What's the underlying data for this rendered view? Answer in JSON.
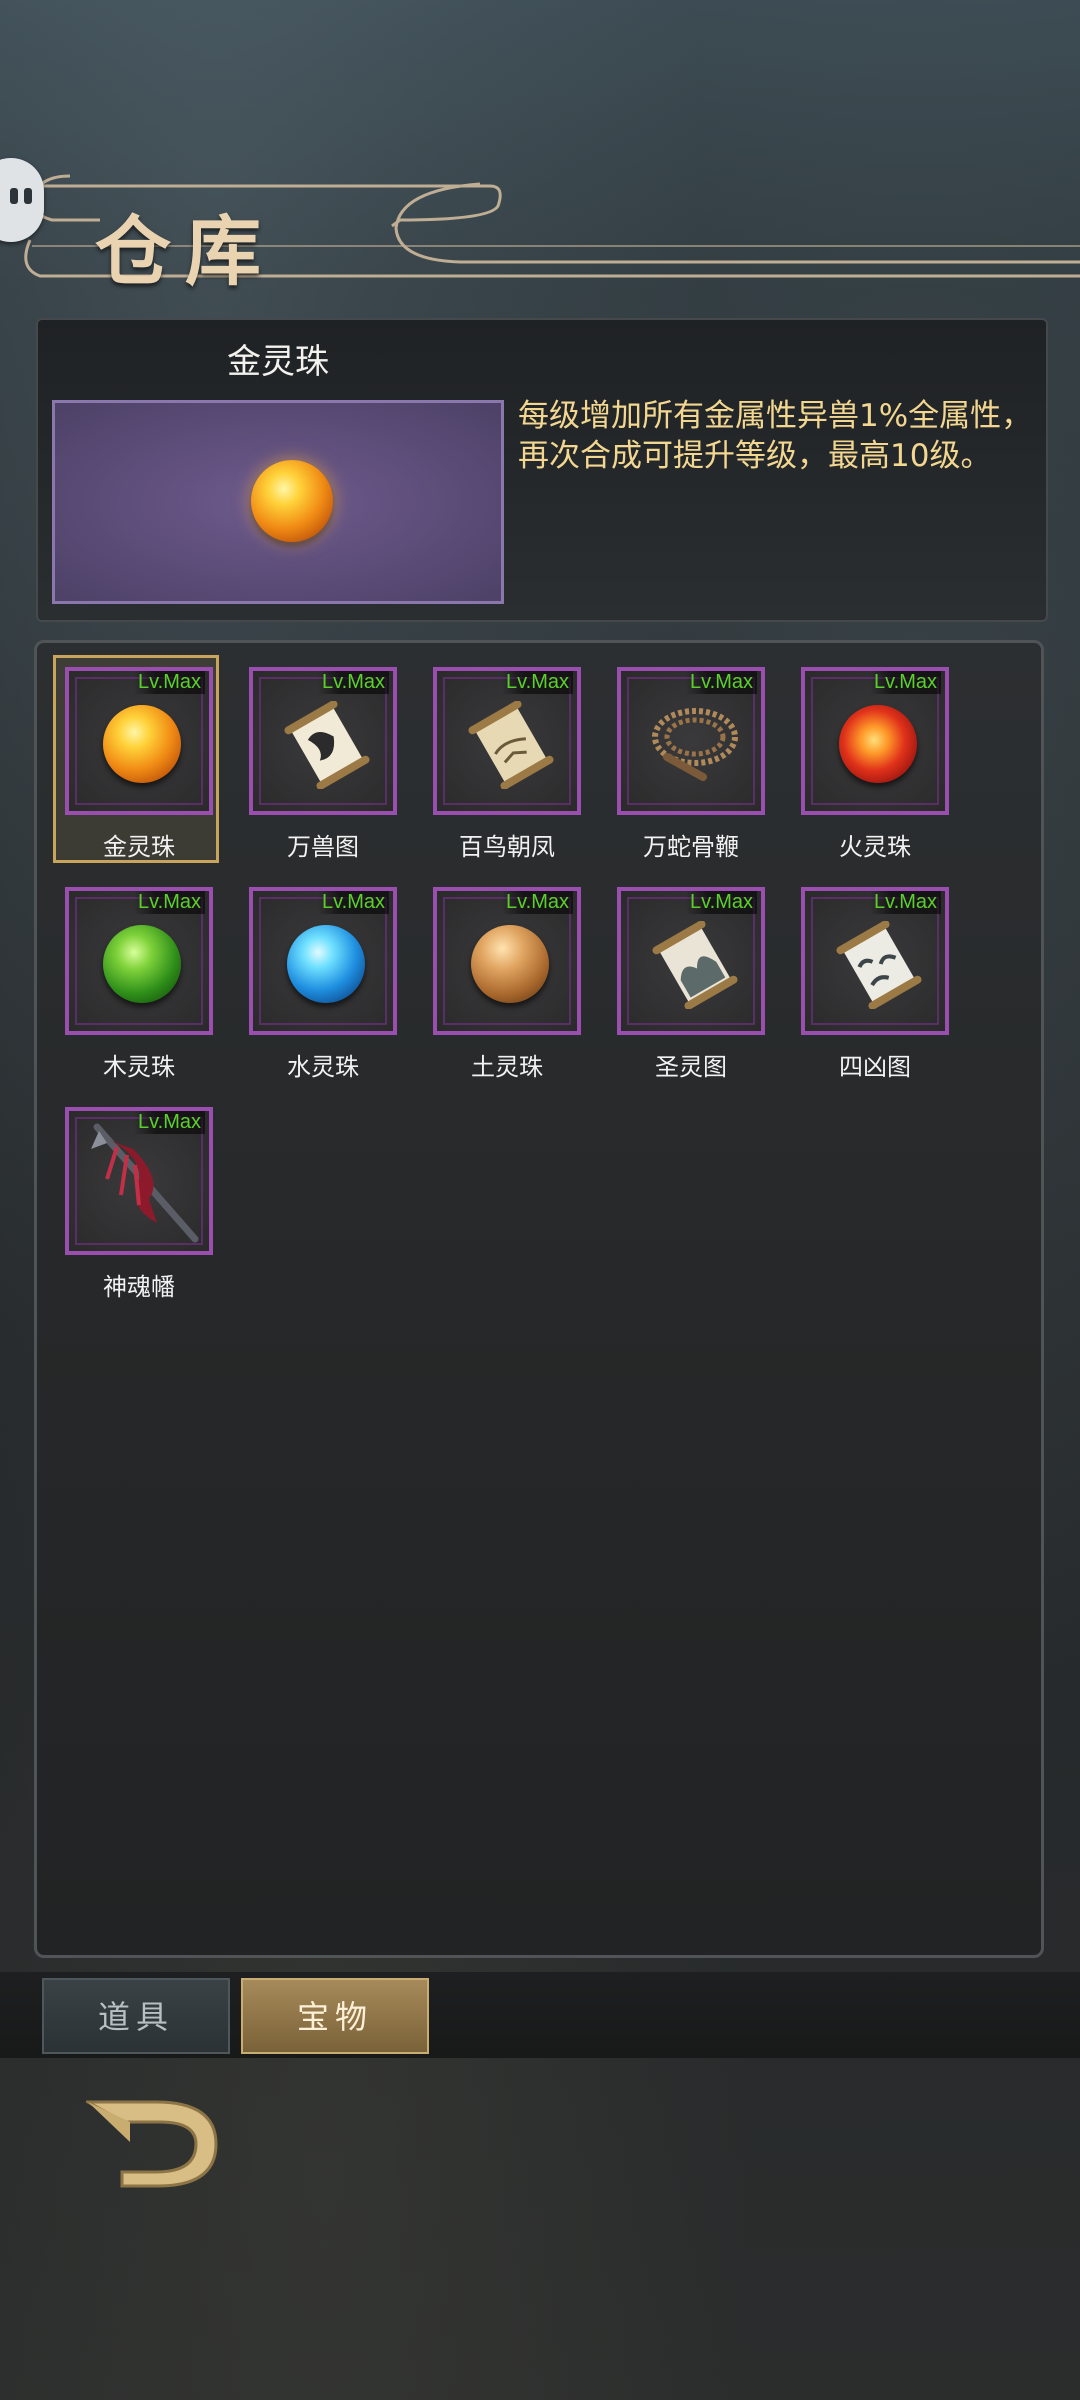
{
  "header": {
    "title": "仓库"
  },
  "detail": {
    "name": "金灵珠",
    "description": "每级增加所有金属性异兽1%全属性，再次合成可提升等级，最高10级。"
  },
  "inventory": {
    "items": [
      {
        "name": "金灵珠",
        "level": "Lv.Max",
        "icon": "gold-orb-icon",
        "selected": true
      },
      {
        "name": "万兽图",
        "level": "Lv.Max",
        "icon": "scroll-icon"
      },
      {
        "name": "百鸟朝凤",
        "level": "Lv.Max",
        "icon": "scroll-icon"
      },
      {
        "name": "万蛇骨鞭",
        "level": "Lv.Max",
        "icon": "whip-icon"
      },
      {
        "name": "火灵珠",
        "level": "Lv.Max",
        "icon": "fire-orb-icon"
      },
      {
        "name": "木灵珠",
        "level": "Lv.Max",
        "icon": "wood-orb-icon"
      },
      {
        "name": "水灵珠",
        "level": "Lv.Max",
        "icon": "water-orb-icon"
      },
      {
        "name": "土灵珠",
        "level": "Lv.Max",
        "icon": "earth-orb-icon"
      },
      {
        "name": "圣灵图",
        "level": "Lv.Max",
        "icon": "scroll-icon"
      },
      {
        "name": "四凶图",
        "level": "Lv.Max",
        "icon": "scroll-icon"
      },
      {
        "name": "神魂幡",
        "level": "Lv.Max",
        "icon": "banner-icon"
      }
    ]
  },
  "tabs": [
    {
      "label": "道具",
      "active": false
    },
    {
      "label": "宝物",
      "active": true
    }
  ],
  "colors": {
    "level_text": "#5cd02a",
    "slot_border": "#9a4fb0",
    "selected_border": "#c9a45c",
    "description_text": "#f3d791"
  }
}
